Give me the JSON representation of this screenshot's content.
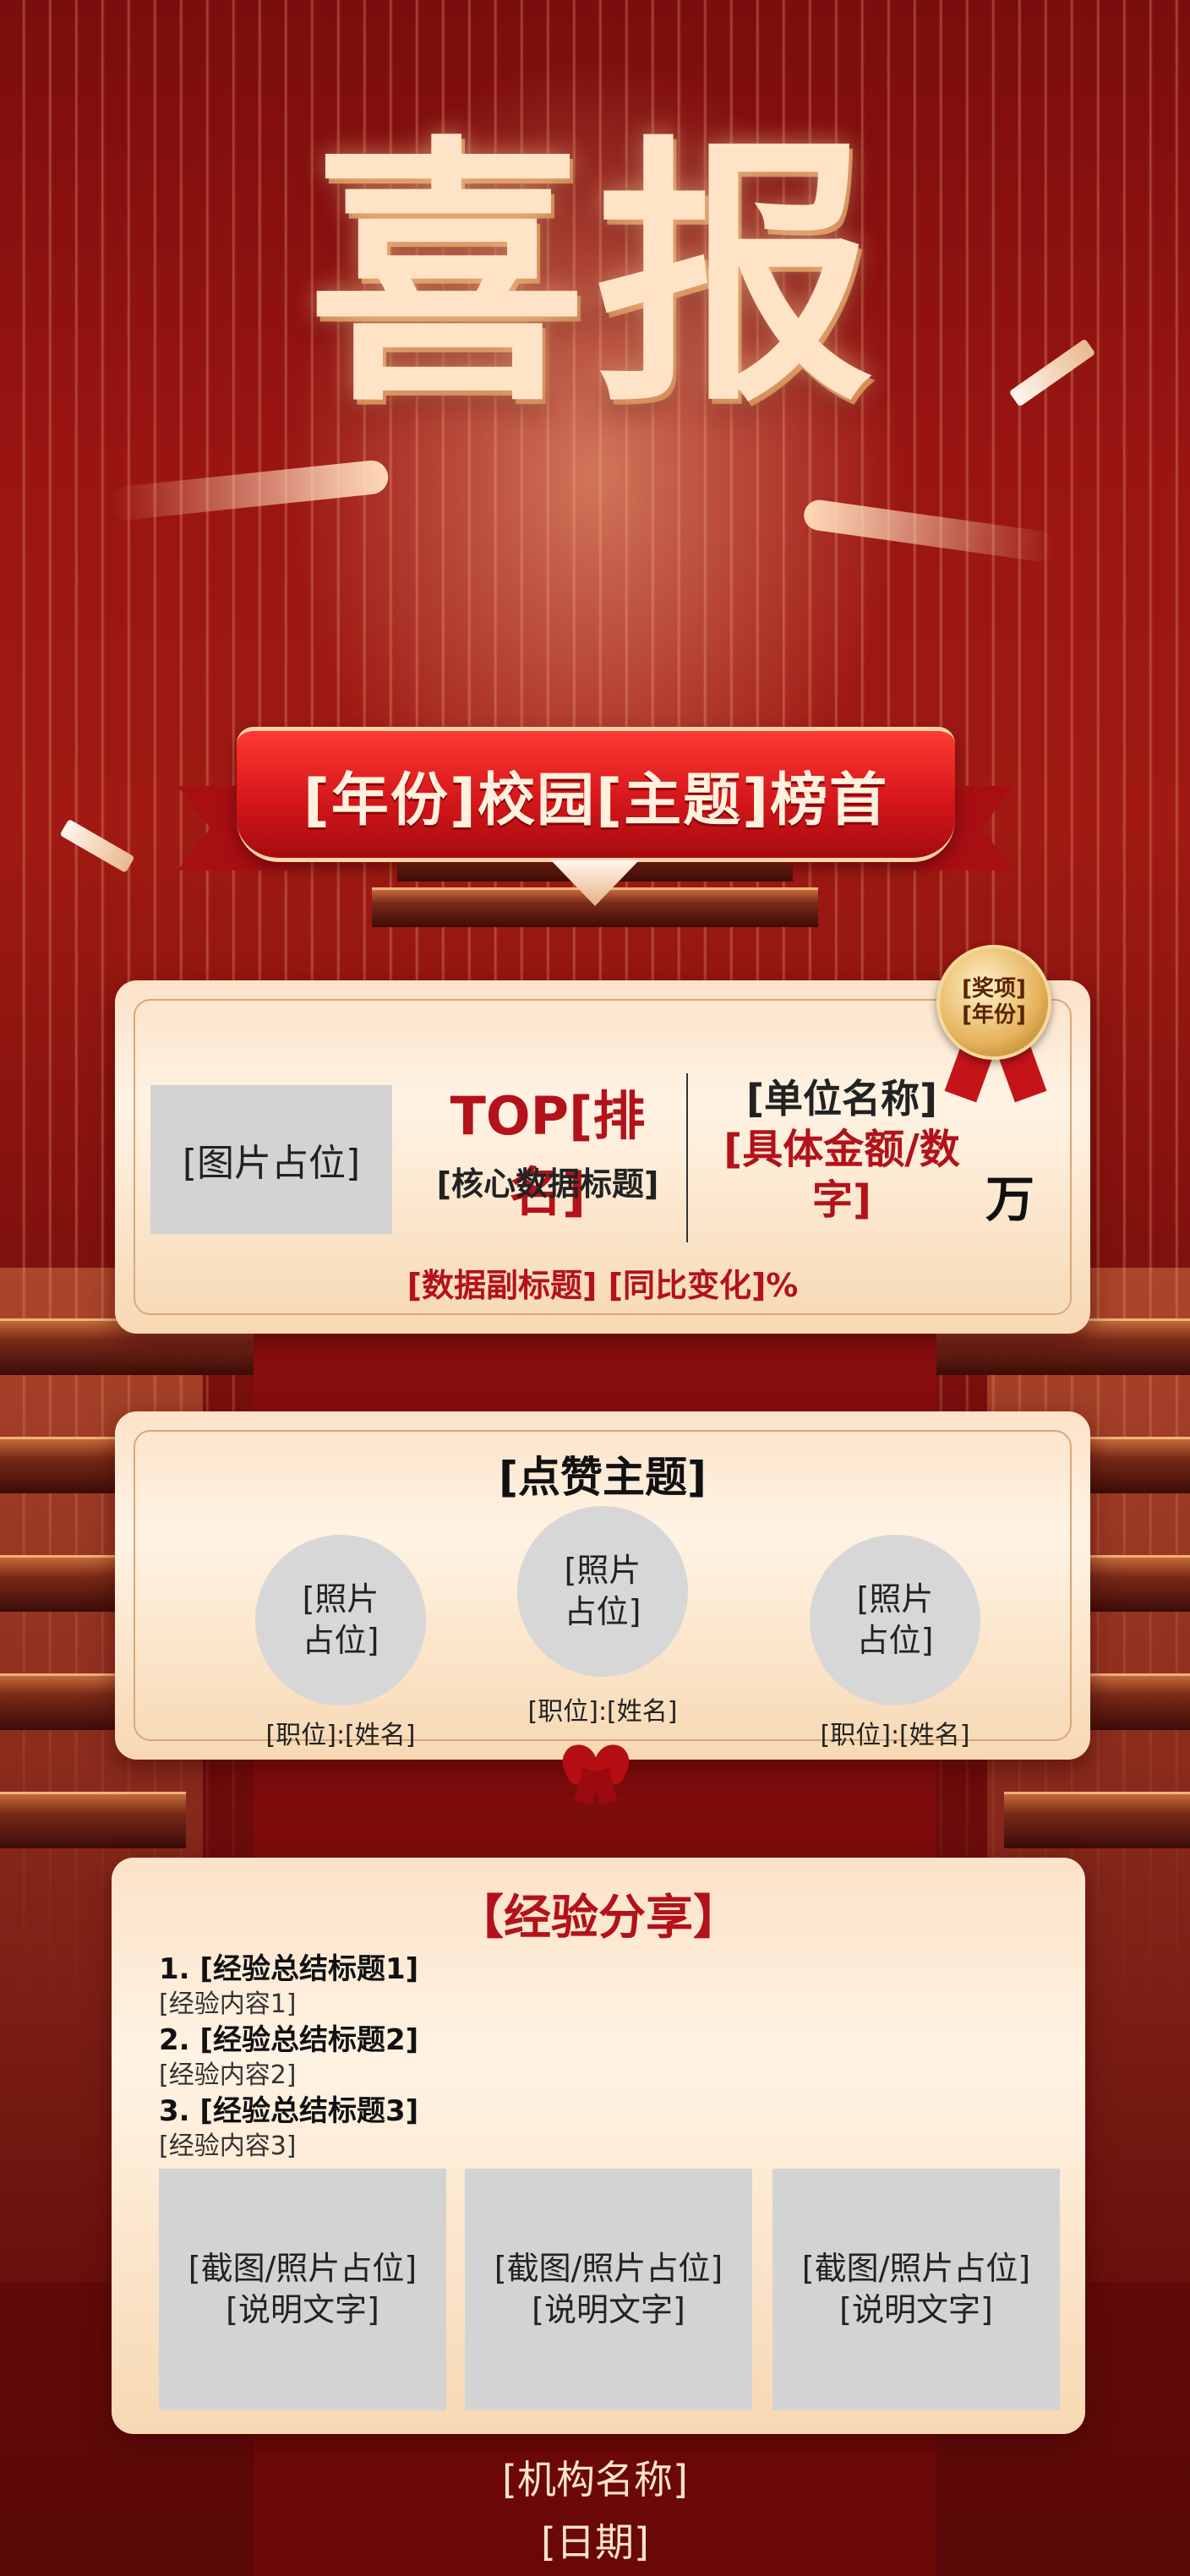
{
  "hero": {
    "title": "喜报"
  },
  "ribbon": {
    "text": "[年份]校园[主题]榜首"
  },
  "award": {
    "medal_line1": "[奖项]",
    "medal_line2": "[年份]",
    "image_placeholder": "[图片占位]",
    "rank": "TOP[排名]",
    "core_data_title": "[核心数据标题]",
    "unit_name": "[单位名称]",
    "amount": "[具体金额/数字]",
    "amount_unit": "万",
    "sub_info": "[数据副标题] [同比变化]%"
  },
  "praise": {
    "title": "[点赞主题]",
    "people": [
      {
        "photo": "[照片\n占位]",
        "caption": "[职位]:[姓名]"
      },
      {
        "photo": "[照片\n占位]",
        "caption": "[职位]:[姓名]"
      },
      {
        "photo": "[照片\n占位]",
        "caption": "[职位]:[姓名]"
      }
    ]
  },
  "experience": {
    "title": "【经验分享】",
    "items": [
      {
        "heading": "1. [经验总结标题1]",
        "content": "[经验内容1]"
      },
      {
        "heading": "2. [经验总结标题2]",
        "content": "[经验内容2]"
      },
      {
        "heading": "3. [经验总结标题3]",
        "content": "[经验内容3]"
      }
    ],
    "screenshots": [
      {
        "line1": "[截图/照片占位]",
        "line2": "[说明文字]"
      },
      {
        "line1": "[截图/照片占位]",
        "line2": "[说明文字]"
      },
      {
        "line1": "[截图/照片占位]",
        "line2": "[说明文字]"
      }
    ]
  },
  "footer": {
    "org": "[机构名称]",
    "date": "[日期]"
  }
}
